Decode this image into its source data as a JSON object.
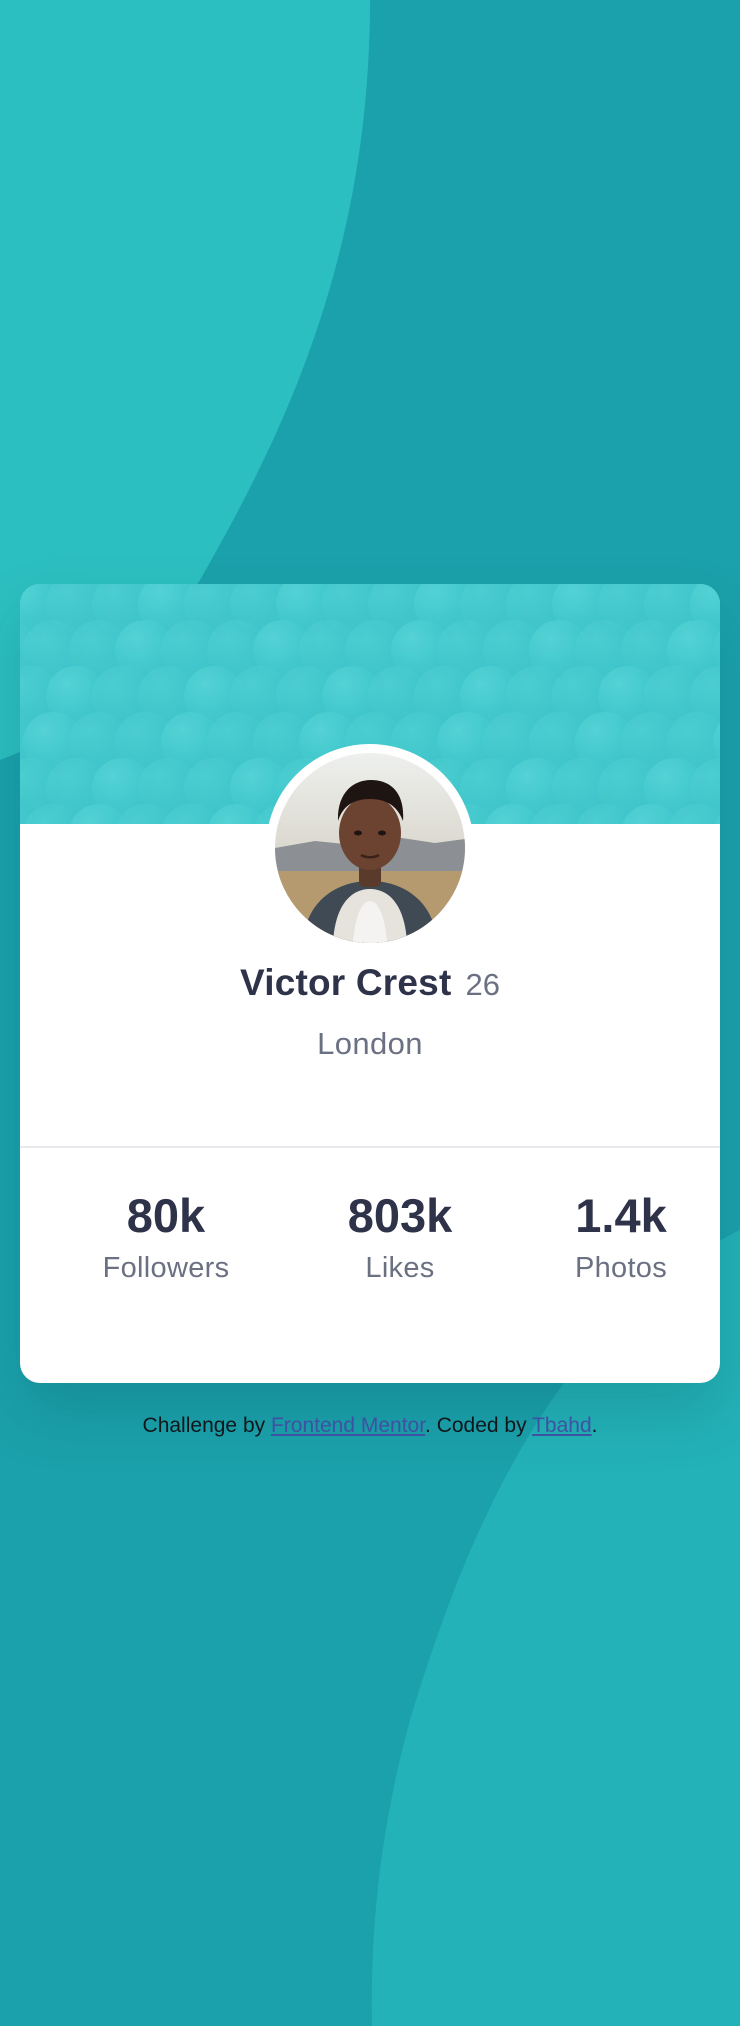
{
  "profile": {
    "name": "Victor Crest",
    "age": "26",
    "city": "London",
    "avatar_icon": "user-portrait"
  },
  "stats": [
    {
      "value": "80k",
      "label": "Followers"
    },
    {
      "value": "803k",
      "label": "Likes"
    },
    {
      "value": "1.4k",
      "label": "Photos"
    }
  ],
  "attribution": {
    "prefix": "Challenge by ",
    "link1": "Frontend Mentor",
    "middle": ". Coded by ",
    "link2": "Tbahd",
    "suffix": "."
  },
  "colors": {
    "background": "#1ba1ab",
    "background_shape_light": "#2cbfc1",
    "card_header": "#3fc4c9",
    "card": "#ffffff",
    "text_dark": "#2e3349",
    "text_muted": "#6b7082",
    "link": "#3e52a3"
  }
}
